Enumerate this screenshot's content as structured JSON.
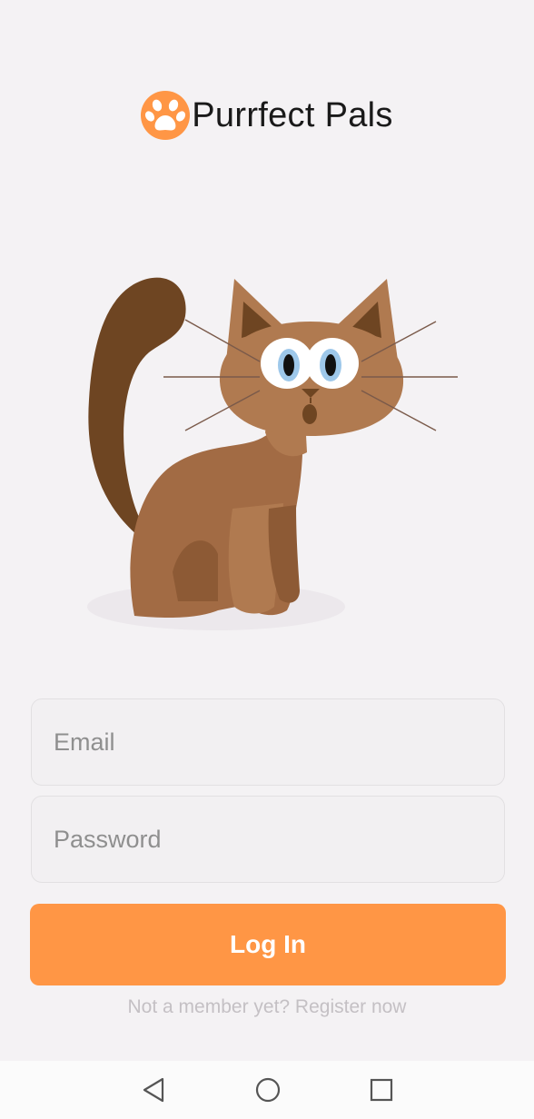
{
  "app": {
    "name": "Purrfect Pals",
    "logo_icon": "paw-icon",
    "accent": "#ff9645"
  },
  "illustration": {
    "subject": "cat-illustration"
  },
  "form": {
    "email_placeholder": "Email",
    "password_placeholder": "Password",
    "login_label": "Log In",
    "register_text": "Not a member yet? Register now"
  },
  "system_nav": {
    "icons": [
      "back-icon",
      "home-icon",
      "recents-icon"
    ]
  }
}
